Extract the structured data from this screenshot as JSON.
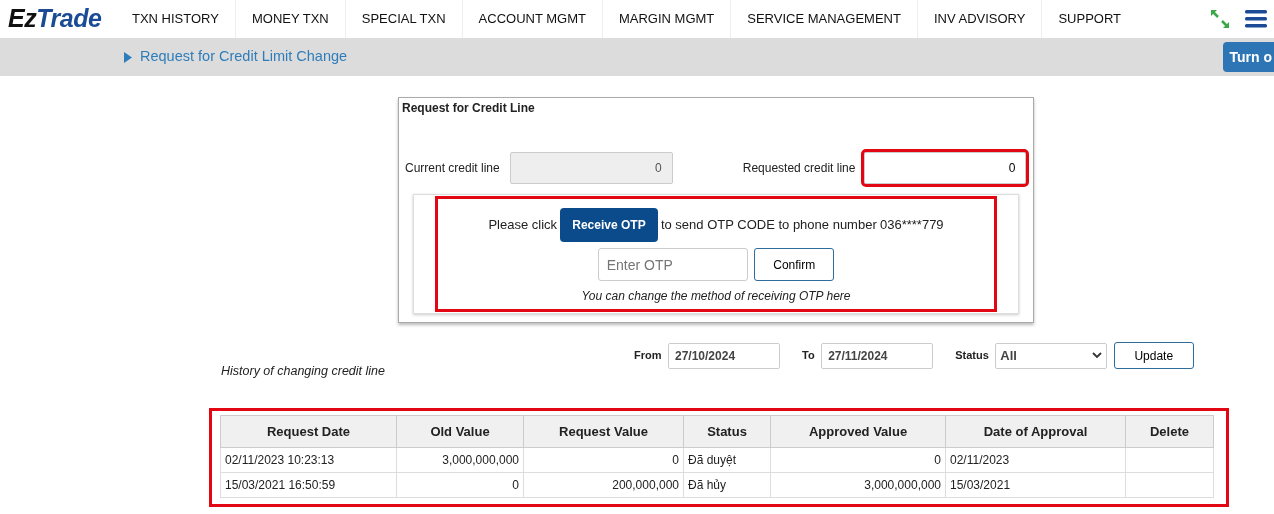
{
  "header": {
    "logo_left": "Ez",
    "logo_right": "Trade",
    "menu": [
      {
        "label": "TXN HISTORY"
      },
      {
        "label": "MONEY TXN"
      },
      {
        "label": "SPECIAL TXN"
      },
      {
        "label": "ACCOUNT MGMT"
      },
      {
        "label": "MARGIN MGMT"
      },
      {
        "label": "SERVICE MANAGEMENT"
      },
      {
        "label": "INV ADVISORY"
      },
      {
        "label": "SUPPORT"
      }
    ]
  },
  "breadcrumb": {
    "title": "Request for Credit Limit Change",
    "side_button": "Turn o"
  },
  "form": {
    "legend": "Request for Credit Line",
    "current": {
      "label": "Current credit line",
      "value": "0",
      "disabled": true
    },
    "requested": {
      "label": "Requested credit line",
      "value": "0",
      "highlighted": true
    },
    "otp": {
      "highlighted": true,
      "before": "Please click",
      "button": "Receive OTP",
      "after": "to send OTP CODE to phone number",
      "phone": "036****779",
      "placeholder": "Enter OTP",
      "confirm": "Confirm",
      "note": "You can change the method of receiving OTP",
      "note_link": "here"
    }
  },
  "history": {
    "title": "History of changing credit line",
    "filters": {
      "from_label": "From",
      "from": "27/10/2024",
      "to_label": "To",
      "to": "27/11/2024",
      "status_label": "Status",
      "status": "All",
      "button": "Update"
    },
    "table": {
      "highlighted": true,
      "columns": [
        {
          "label": "Request Date",
          "numeric": false
        },
        {
          "label": "Old Value",
          "numeric": true
        },
        {
          "label": "Request Value",
          "numeric": true
        },
        {
          "label": "Status",
          "numeric": false
        },
        {
          "label": "Approved Value",
          "numeric": true
        },
        {
          "label": "Date of Approval",
          "numeric": false
        },
        {
          "label": "Delete"
        }
      ],
      "rows": [
        [
          "02/11/2023 10:23:13",
          "3,000,000,000",
          "0",
          "Đã duyệt",
          "0",
          "02/11/2023",
          null
        ],
        [
          "15/03/2021 16:50:59",
          "0",
          "200,000,000",
          "Đã hủy",
          "3,000,000,000",
          "15/03/2021",
          null
        ]
      ]
    }
  }
}
